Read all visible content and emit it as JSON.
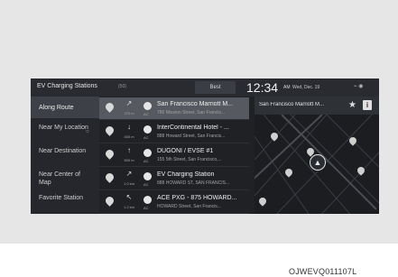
{
  "header": {
    "title": "EV Charging Stations",
    "count": "(50)",
    "sort_button": "Best",
    "time": "12:34",
    "ampm": "AM",
    "date": "Wed, Dec. 19",
    "status_icons": "⌁ ◉"
  },
  "sidebar": {
    "items": [
      {
        "label": "Along Route",
        "active": true
      },
      {
        "label": "Near My Location",
        "active": false
      },
      {
        "label": "Near Destination",
        "active": false
      },
      {
        "label": "Near Center of Map",
        "active": false
      },
      {
        "label": "Favorite Station",
        "active": false
      }
    ],
    "location_dot": "○"
  },
  "stations": [
    {
      "name": "San Francisco Marriott M...",
      "address": "780 Mission Street, San Francis...",
      "distance": "270 m",
      "direction": "↗",
      "type": "AC",
      "selected": true
    },
    {
      "name": "InterContinental Hotel - ...",
      "address": "888 Howard Street, San Francis...",
      "distance": "400 m",
      "direction": "↓",
      "type": "AC",
      "selected": false
    },
    {
      "name": "DUGONI / EVSE #1",
      "address": "155 5th Street, San Francisco,...",
      "distance": "500 m",
      "direction": "↑",
      "type": "AC",
      "selected": false
    },
    {
      "name": "EV Charging Station",
      "address": "888 HOWARD ST, SAN FRANCIS...",
      "distance": "1.0 km",
      "direction": "↗",
      "type": "AC",
      "selected": false
    },
    {
      "name": "ACE PXG - 875 HOWARD...",
      "address": "HOWARD Street, San Francis...",
      "distance": "1.2 km",
      "direction": "↖",
      "type": "AC",
      "selected": false
    }
  ],
  "map": {
    "popup_name": "San Francisco Marriott M...",
    "star_icon": "★",
    "info_icon": "i",
    "nav_icon": "▲"
  },
  "caption": "OJWEVQ011107L",
  "colors": {
    "screen_bg": "#1f2125",
    "selected_row": "#56595f",
    "active_sidebar": "#3d4046"
  }
}
